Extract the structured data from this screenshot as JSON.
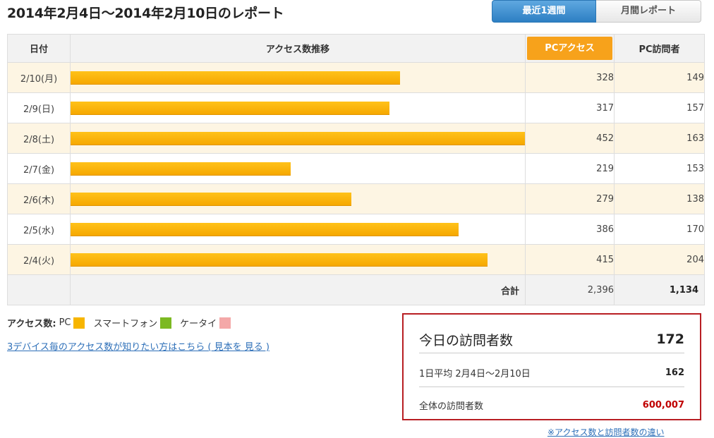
{
  "title": "2014年2月4日〜2014年2月10日のレポート",
  "tabs": {
    "weekly": "最近1週間",
    "monthly": "月間レポート"
  },
  "table": {
    "headers": {
      "date": "日付",
      "trend": "アクセス数推移",
      "pc_access": "PCアクセス",
      "pc_visitors": "PC訪問者"
    },
    "rows": [
      {
        "date": "2/10(月)",
        "access": 328,
        "visitors": 149
      },
      {
        "date": "2/9(日)",
        "access": 317,
        "visitors": 157
      },
      {
        "date": "2/8(土)",
        "access": 452,
        "visitors": 163
      },
      {
        "date": "2/7(金)",
        "access": 219,
        "visitors": 153
      },
      {
        "date": "2/6(木)",
        "access": 279,
        "visitors": 138
      },
      {
        "date": "2/5(水)",
        "access": 386,
        "visitors": 170
      },
      {
        "date": "2/4(火)",
        "access": 415,
        "visitors": 204
      }
    ],
    "total_label": "合計",
    "total_access": "2,396",
    "total_visitors": "1,134"
  },
  "legend": {
    "label": "アクセス数:",
    "pc": "PC",
    "smartphone": "スマートフォン",
    "keitai": "ケータイ"
  },
  "link_text": "3デバイス毎のアクセス数が知りたい方はこちら ( 見本を 見る )",
  "visitors_box": {
    "today_label": "今日の訪問者数",
    "today_value": "172",
    "avg_label": "1日平均 2月4日〜2月10日",
    "avg_value": "162",
    "total_label": "全体の訪問者数",
    "total_value": "600,007"
  },
  "footnote": "※アクセス数と訪問者数の違い",
  "colors": {
    "bar": "#f6a800",
    "accent": "#f7a21b",
    "tab_active": "#2d7fc3",
    "box_border": "#b81e23",
    "total_red": "#c00000"
  }
}
